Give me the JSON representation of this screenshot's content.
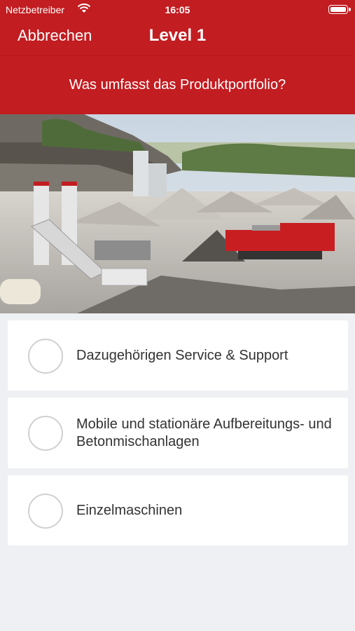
{
  "status_bar": {
    "carrier": "Netzbetreiber",
    "time": "16:05",
    "icons": [
      "wifi-icon",
      "battery-icon"
    ]
  },
  "nav": {
    "cancel_label": "Abbrechen",
    "title": "Level 1"
  },
  "question": "Was umfasst das Produktportfolio?",
  "answers": [
    {
      "label": "Dazugehörigen Service & Support"
    },
    {
      "label": "Mobile und stationäre Aufbereitungs- und Betonmischanlagen"
    },
    {
      "label": "Einzelmaschinen"
    }
  ],
  "colors": {
    "brand_red": "#c21d21",
    "background": "#eef0f3",
    "card": "#ffffff",
    "radio_border": "#d0d0d0"
  }
}
